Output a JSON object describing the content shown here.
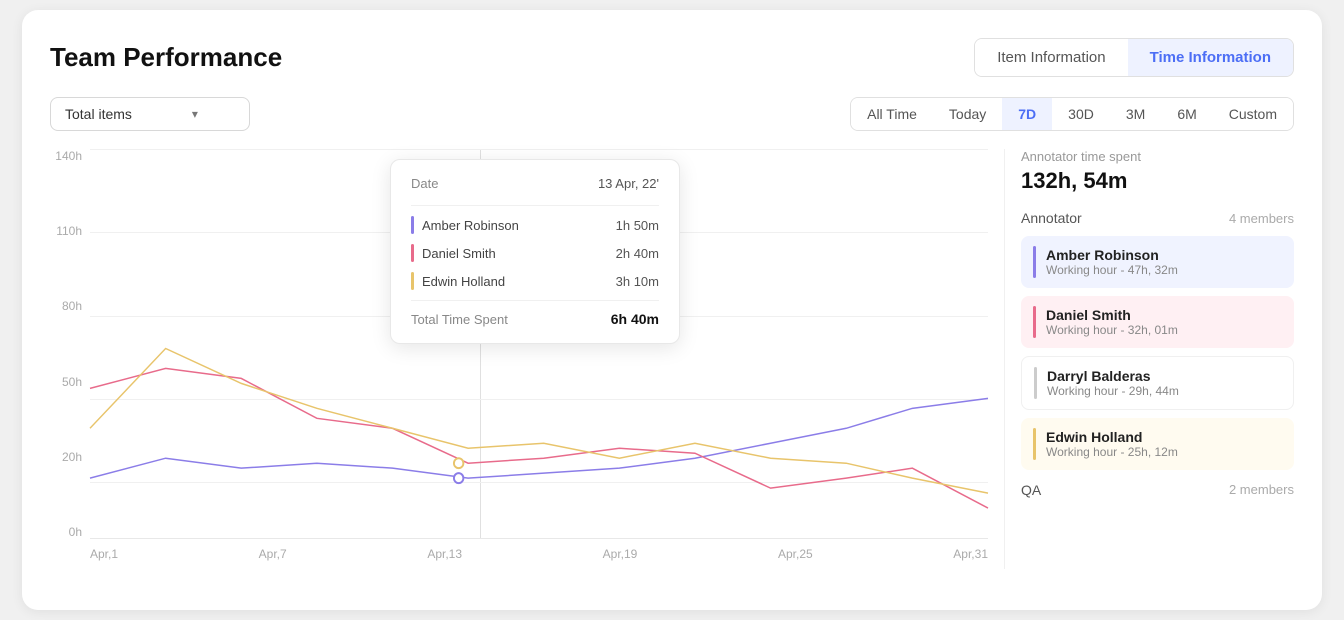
{
  "page": {
    "title": "Team Performance"
  },
  "tabs": {
    "item_info": "Item Information",
    "time_info": "Time Information",
    "active": "time"
  },
  "dropdown": {
    "label": "Total items",
    "chevron": "▾"
  },
  "time_filters": [
    {
      "id": "all",
      "label": "All Time",
      "active": false
    },
    {
      "id": "today",
      "label": "Today",
      "active": false
    },
    {
      "id": "7d",
      "label": "7D",
      "active": true
    },
    {
      "id": "30d",
      "label": "30D",
      "active": false
    },
    {
      "id": "3m",
      "label": "3M",
      "active": false
    },
    {
      "id": "6m",
      "label": "6M",
      "active": false
    },
    {
      "id": "custom",
      "label": "Custom",
      "active": false
    }
  ],
  "chart": {
    "y_labels": [
      "140h",
      "110h",
      "80h",
      "50h",
      "20h",
      "0h"
    ],
    "x_labels": [
      "Apr,1",
      "Apr,7",
      "Apr,13",
      "Apr,19",
      "Apr,25",
      "Apr,31"
    ]
  },
  "tooltip": {
    "date_label": "Date",
    "date_value": "13 Apr, 22'",
    "rows": [
      {
        "name": "Amber Robinson",
        "time": "1h 50m",
        "color": "#8b7de8"
      },
      {
        "name": "Daniel Smith",
        "time": "2h 40m",
        "color": "#e86b8b"
      },
      {
        "name": "Edwin Holland",
        "time": "3h 10m",
        "color": "#e8c46b"
      }
    ],
    "total_label": "Total Time Spent",
    "total_value": "6h 40m"
  },
  "right_panel": {
    "annotator_time_label": "Annotator time spent",
    "annotator_time_value": "132h, 54m",
    "annotator_section_title": "Annotator",
    "annotator_count": "4  members",
    "members": [
      {
        "name": "Amber Robinson",
        "hours": "Working hour - 47h, 32m",
        "color": "#8b7de8",
        "style": "blue"
      },
      {
        "name": "Daniel Smith",
        "hours": "Working hour - 32h, 01m",
        "color": "#e86b8b",
        "style": "pink"
      },
      {
        "name": "Darryl Balderas",
        "hours": "Working hour - 29h, 44m",
        "color": "#cccccc",
        "style": "plain"
      },
      {
        "name": "Edwin Holland",
        "hours": "Working hour - 25h, 12m",
        "color": "#e8c46b",
        "style": "yellow"
      }
    ],
    "qa_title": "QA",
    "qa_count": "2  members"
  }
}
